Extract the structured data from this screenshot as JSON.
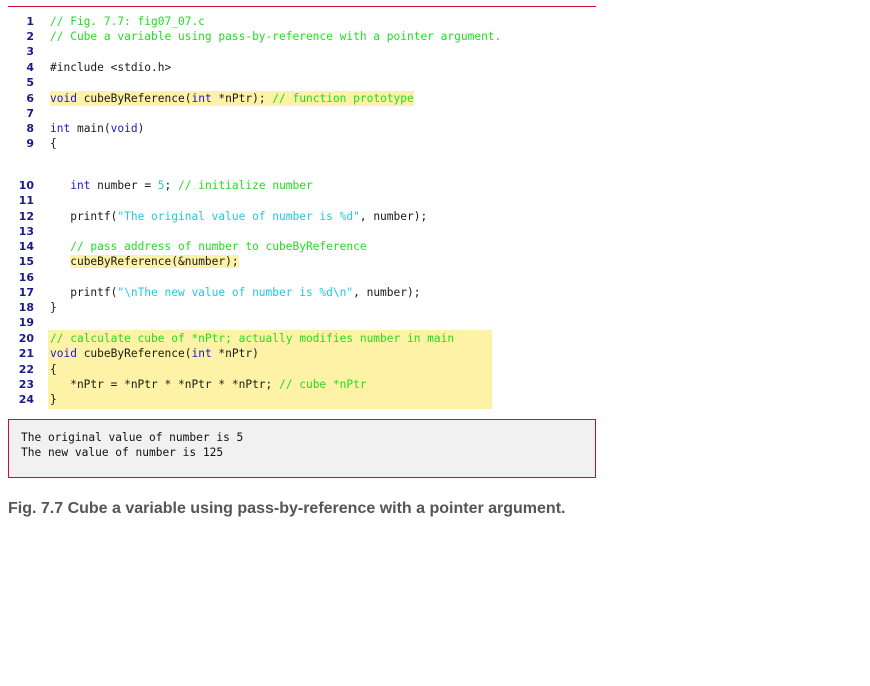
{
  "colors": {
    "rule": "#c8102e",
    "highlight": "#fdf2a6",
    "keyword": "#1a1ad0",
    "comment": "#22dd22",
    "string": "#22c8e0",
    "line_number": "#1a1a8c",
    "output_bg": "#f1f1f1",
    "caption": "#555555"
  },
  "code": {
    "lines": [
      {
        "n": "1",
        "segments": [
          {
            "t": "// Fig. 7.7: fig07_07.c",
            "c": "cm"
          }
        ]
      },
      {
        "n": "2",
        "segments": [
          {
            "t": "// Cube a variable using pass-by-reference with a pointer argument.",
            "c": "cm"
          }
        ]
      },
      {
        "n": "3",
        "segments": []
      },
      {
        "n": "4",
        "segments": [
          {
            "t": "#include <stdio.h>",
            "c": ""
          }
        ]
      },
      {
        "n": "5",
        "segments": []
      },
      {
        "n": "6",
        "highlight": true,
        "segments": [
          {
            "t": "void",
            "c": "kw"
          },
          {
            "t": " cubeByReference(",
            "c": ""
          },
          {
            "t": "int",
            "c": "kw"
          },
          {
            "t": " *nPtr); ",
            "c": ""
          },
          {
            "t": "// function prototype",
            "c": "cm"
          }
        ]
      },
      {
        "n": "7",
        "segments": []
      },
      {
        "n": "8",
        "segments": [
          {
            "t": "int",
            "c": "kw"
          },
          {
            "t": " main(",
            "c": ""
          },
          {
            "t": "void",
            "c": "kw"
          },
          {
            "t": ")",
            "c": ""
          }
        ]
      },
      {
        "n": "9",
        "segments": [
          {
            "t": "{",
            "c": ""
          }
        ]
      },
      {
        "n": "10",
        "segments": [
          {
            "t": "   ",
            "c": ""
          },
          {
            "t": "int",
            "c": "kw"
          },
          {
            "t": " number = ",
            "c": ""
          },
          {
            "t": "5",
            "c": "st"
          },
          {
            "t": "; ",
            "c": ""
          },
          {
            "t": "// initialize number",
            "c": "cm"
          }
        ]
      },
      {
        "n": "11",
        "segments": []
      },
      {
        "n": "12",
        "segments": [
          {
            "t": "   printf(",
            "c": ""
          },
          {
            "t": "\"The original value of number is %d\"",
            "c": "st"
          },
          {
            "t": ", number);",
            "c": ""
          }
        ]
      },
      {
        "n": "13",
        "segments": []
      },
      {
        "n": "14",
        "segments": [
          {
            "t": "   ",
            "c": ""
          },
          {
            "t": "// pass address of number to cubeByReference",
            "c": "cm"
          }
        ]
      },
      {
        "n": "15",
        "segments": [
          {
            "t": "   ",
            "c": ""
          },
          {
            "t": "cubeByReference(&number);",
            "c": "",
            "hl": true
          }
        ]
      },
      {
        "n": "16",
        "segments": []
      },
      {
        "n": "17",
        "segments": [
          {
            "t": "   printf(",
            "c": ""
          },
          {
            "t": "\"\\nThe new value of number is %d\\n\"",
            "c": "st"
          },
          {
            "t": ", number);",
            "c": ""
          }
        ]
      },
      {
        "n": "18",
        "segments": [
          {
            "t": "}",
            "c": ""
          }
        ]
      },
      {
        "n": "19",
        "segments": []
      },
      {
        "n": "20",
        "segments": [
          {
            "t": "// calculate cube of *nPtr; actually modifies number in main",
            "c": "cm"
          }
        ]
      },
      {
        "n": "21",
        "segments": [
          {
            "t": "void",
            "c": "kw"
          },
          {
            "t": " cubeByReference(",
            "c": ""
          },
          {
            "t": "int",
            "c": "kw"
          },
          {
            "t": " *nPtr)",
            "c": ""
          }
        ]
      },
      {
        "n": "22",
        "segments": [
          {
            "t": "{",
            "c": ""
          }
        ]
      },
      {
        "n": "23",
        "segments": [
          {
            "t": "   *nPtr = *nPtr * *nPtr * *nPtr; ",
            "c": ""
          },
          {
            "t": "// cube *nPtr",
            "c": "cm"
          }
        ]
      },
      {
        "n": "24",
        "segments": [
          {
            "t": "}",
            "c": ""
          }
        ]
      }
    ]
  },
  "output": {
    "lines": [
      "The original value of number is 5",
      "The new value of number is 125"
    ]
  },
  "caption": "Fig. 7.7 Cube a variable using pass-by-reference with a pointer argument."
}
